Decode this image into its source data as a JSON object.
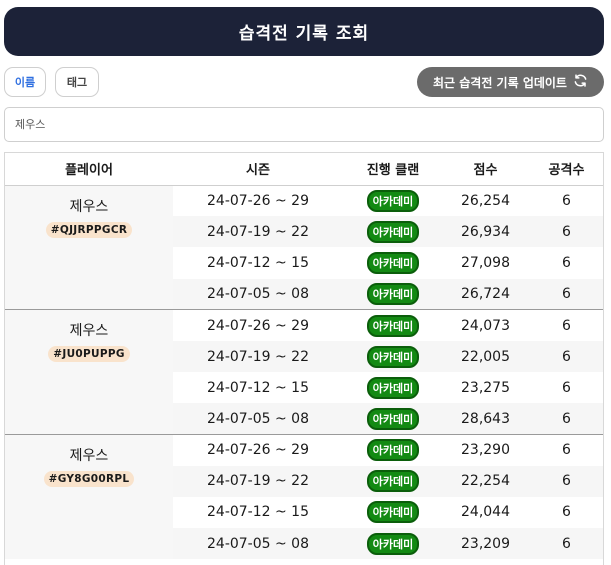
{
  "page_title": "습격전 기록 조회",
  "tabs": {
    "name_label": "이름",
    "tag_label": "태그"
  },
  "update_button": {
    "label": "최근 습격전 기록 업데이트",
    "icon": "refresh-icon"
  },
  "search": {
    "value": "제우스",
    "placeholder": "제우스"
  },
  "table": {
    "headers": [
      "플레이어",
      "시즌",
      "진행 클랜",
      "점수",
      "공격수"
    ],
    "groups": [
      {
        "player": "제우스",
        "tag": "#QJJRPPGCR",
        "rows": [
          {
            "season": "24-07-26 ~ 29",
            "clan": "아카데미",
            "score": "26,254",
            "attacks": "6"
          },
          {
            "season": "24-07-19 ~ 22",
            "clan": "아카데미",
            "score": "26,934",
            "attacks": "6"
          },
          {
            "season": "24-07-12 ~ 15",
            "clan": "아카데미",
            "score": "27,098",
            "attacks": "6"
          },
          {
            "season": "24-07-05 ~ 08",
            "clan": "아카데미",
            "score": "26,724",
            "attacks": "6"
          }
        ]
      },
      {
        "player": "제우스",
        "tag": "#JU0PUPPG",
        "rows": [
          {
            "season": "24-07-26 ~ 29",
            "clan": "아카데미",
            "score": "24,073",
            "attacks": "6"
          },
          {
            "season": "24-07-19 ~ 22",
            "clan": "아카데미",
            "score": "22,005",
            "attacks": "6"
          },
          {
            "season": "24-07-12 ~ 15",
            "clan": "아카데미",
            "score": "23,275",
            "attacks": "6"
          },
          {
            "season": "24-07-05 ~ 08",
            "clan": "아카데미",
            "score": "28,643",
            "attacks": "6"
          }
        ]
      },
      {
        "player": "제우스",
        "tag": "#GY8G00RPL",
        "rows": [
          {
            "season": "24-07-26 ~ 29",
            "clan": "아카데미",
            "score": "23,290",
            "attacks": "6"
          },
          {
            "season": "24-07-19 ~ 22",
            "clan": "아카데미",
            "score": "22,254",
            "attacks": "6"
          },
          {
            "season": "24-07-12 ~ 15",
            "clan": "아카데미",
            "score": "24,044",
            "attacks": "6"
          },
          {
            "season": "24-07-05 ~ 08",
            "clan": "아카데미",
            "score": "23,209",
            "attacks": "6"
          }
        ]
      }
    ]
  },
  "colors": {
    "title_bg": "#1c2238",
    "update_button_bg": "#6b6b6b",
    "clan_badge_bg": "#138a13",
    "tag_badge_bg": "#f9e3cc",
    "active_tab_text": "#2f6fe0"
  }
}
